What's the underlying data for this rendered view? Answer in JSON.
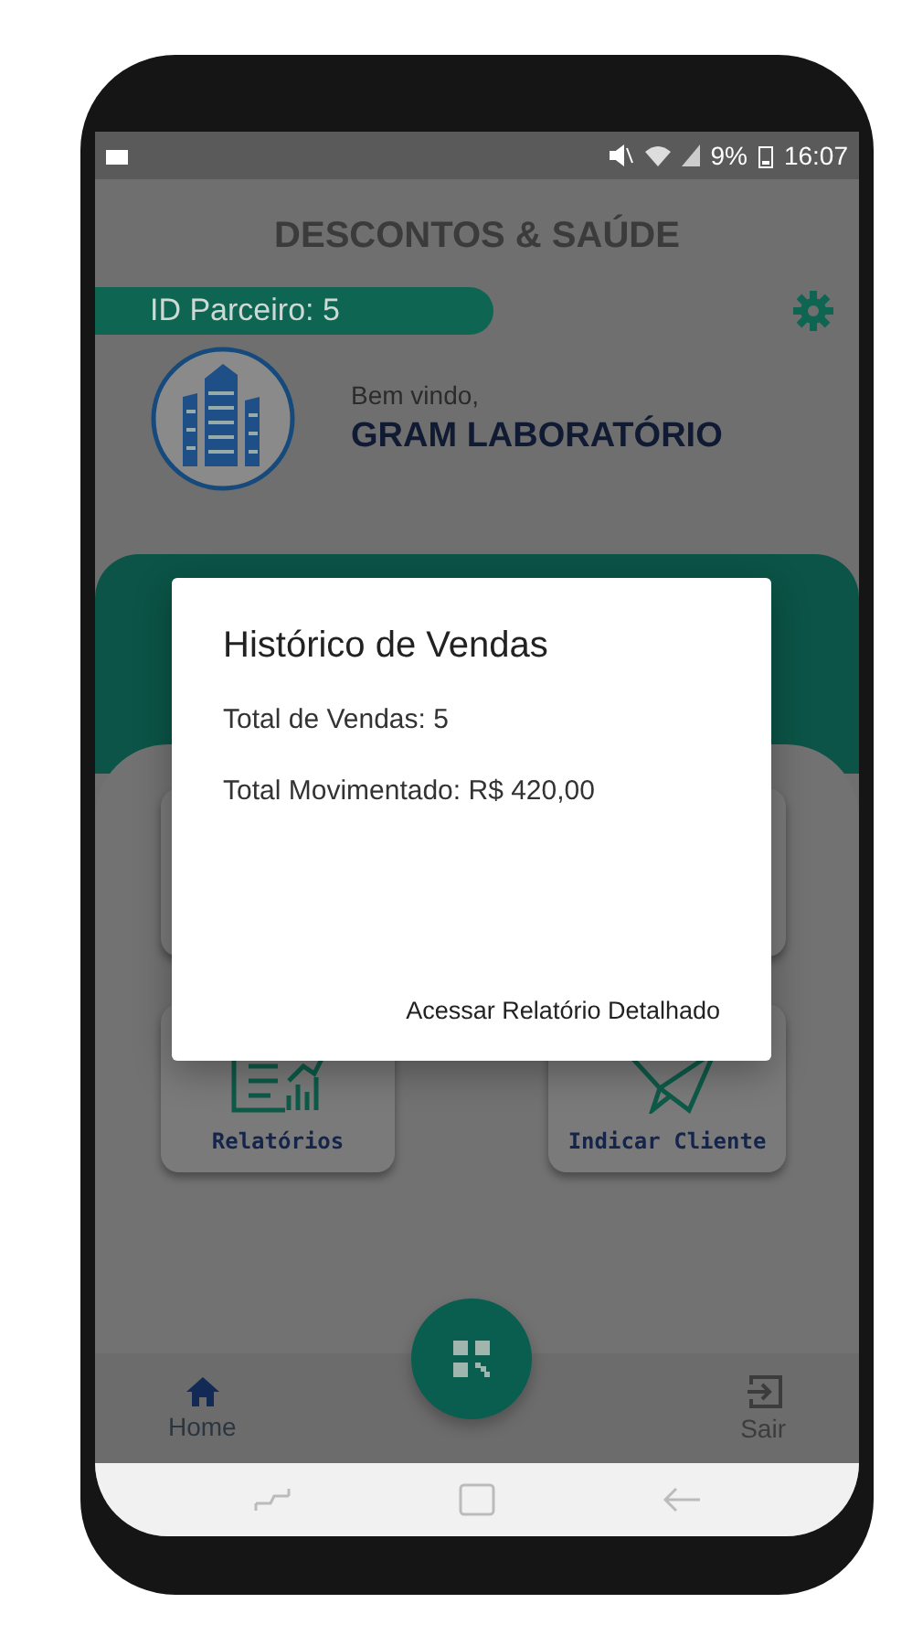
{
  "status_bar": {
    "battery": "9%",
    "time": "16:07"
  },
  "app_bar": {
    "title": "DESCONTOS & SAÚDE"
  },
  "partner": {
    "id_label": "ID Parceiro: 5",
    "greeting": "Bem vindo,",
    "name": "GRAM LABORATÓRIO"
  },
  "menu_cards": [
    {
      "label": "Relatórios",
      "kind": "reports"
    },
    {
      "label": "Indicar Cliente",
      "kind": "send"
    }
  ],
  "dialog": {
    "title": "Histórico de Vendas",
    "lines": [
      "Total de Vendas: 5",
      "Total Movimentado: R$ 420,00"
    ],
    "action": "Acessar Relatório Detalhado"
  },
  "bottom_nav": [
    {
      "label": "Home",
      "kind": "home",
      "selected": true
    },
    {
      "label": "Sair",
      "kind": "exit",
      "selected": false
    }
  ]
}
